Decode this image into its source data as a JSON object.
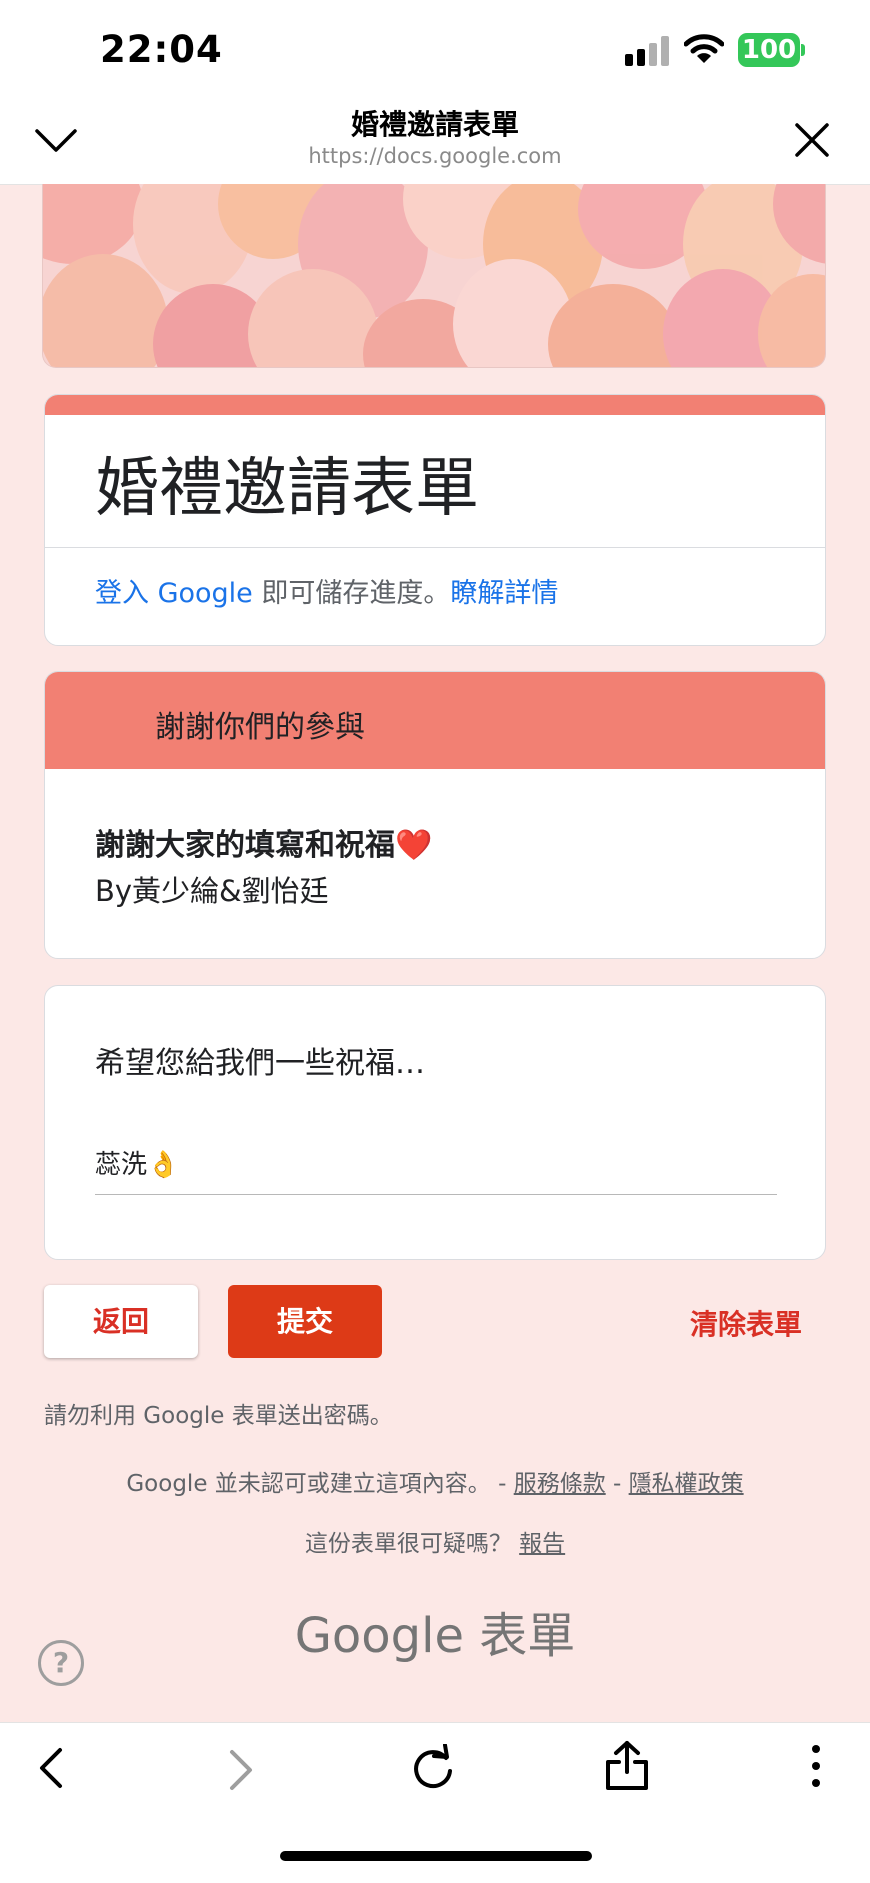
{
  "status_bar": {
    "time": "22:04",
    "battery": "100",
    "icons": [
      "signal-icon",
      "wifi-icon",
      "battery-icon"
    ]
  },
  "browser": {
    "title": "婚禮邀請表單",
    "url": "https://docs.google.com",
    "icons": [
      "chevron-down-icon",
      "close-icon"
    ]
  },
  "form": {
    "title": "婚禮邀請表單",
    "signin": {
      "link": "登入 Google",
      "middle": " 即可儲存進度。",
      "learn_more": "瞭解詳情"
    },
    "section": {
      "title": "謝謝你們的參與",
      "text_line1": "謝謝大家的填寫和祝福❤️",
      "text_line2": "By黃少綸&劉怡廷"
    },
    "question": {
      "label": "希望您給我們一些祝福…",
      "answer": "蕊洗👌"
    },
    "buttons": {
      "back": "返回",
      "submit": "提交",
      "clear": "清除表單"
    }
  },
  "footer": {
    "password_warning": "請勿利用 Google 表單送出密碼。",
    "disclaimer": "Google 並未認可或建立這項內容。 - ",
    "terms": "服務條款",
    "separator": " - ",
    "privacy": "隱私權政策",
    "suspicious": "這份表單很可疑嗎？ ",
    "report": "報告",
    "logo": "Google 表單",
    "help": "?"
  },
  "toolbar": {
    "icons": [
      "back-arrow-icon",
      "forward-arrow-icon",
      "reload-icon",
      "share-icon",
      "more-vert-icon"
    ]
  },
  "colors": {
    "accent": "#f28073",
    "background": "#fce8e6",
    "submit": "#dd3a17",
    "link": "#1a73e8"
  }
}
